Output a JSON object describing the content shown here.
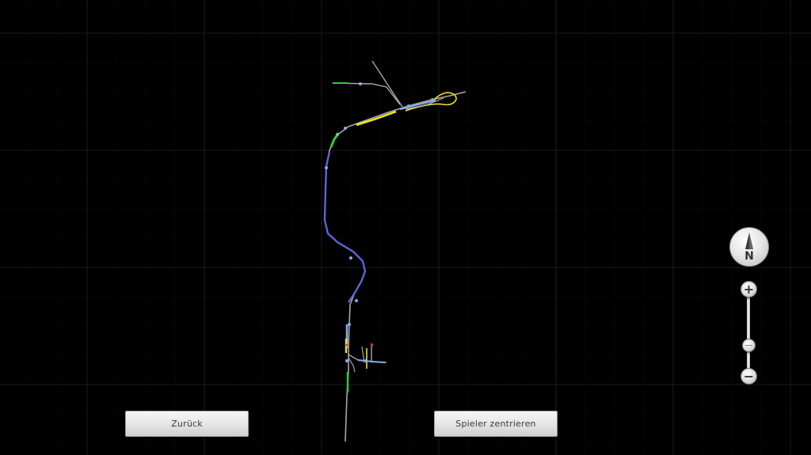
{
  "buttons": {
    "back_label": "Zurück",
    "center_label": "Spieler zentrieren"
  },
  "compass": {
    "label": "N",
    "icon": "compass-north-icon"
  },
  "zoom": {
    "in_label": "+",
    "out_label": "−",
    "level": 0.35
  },
  "map": {
    "background": "#000000",
    "grid_color": "#1c1c1c",
    "track_colors": {
      "track": "#a8a8a8",
      "section_blue": "#5a66d8",
      "section_yellow": "#f2e21c",
      "section_green": "#33cc33",
      "signal": "#7fb0e8"
    }
  }
}
